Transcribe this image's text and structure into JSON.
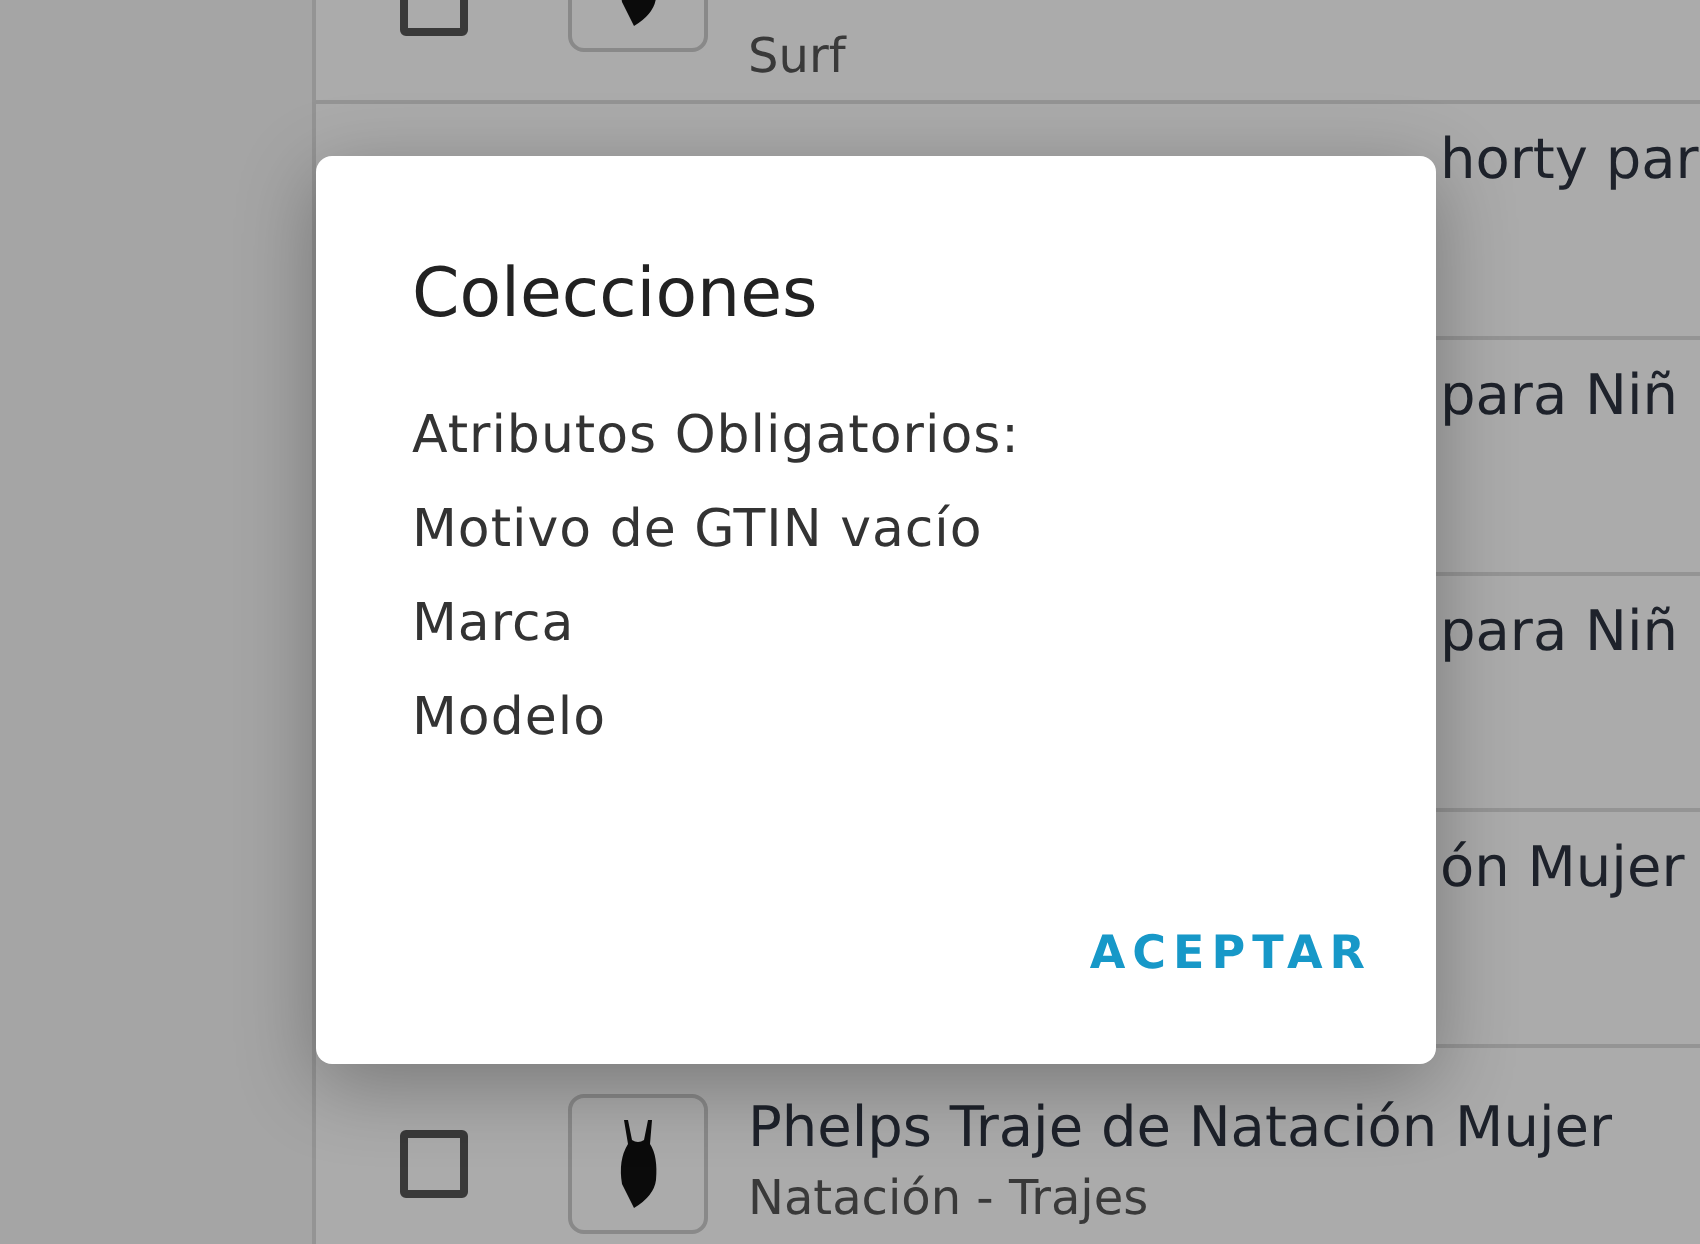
{
  "list": {
    "items": [
      {
        "kind": "visible",
        "checked": false,
        "subtitle": "Surf"
      },
      {
        "kind": "covered",
        "title": "horty par"
      },
      {
        "kind": "covered",
        "title": "para Niñ"
      },
      {
        "kind": "covered",
        "title": "para Niñ"
      },
      {
        "kind": "covered",
        "title": "ón Mujer"
      },
      {
        "kind": "visible",
        "checked": false,
        "title": "Phelps Traje de Natación Mujer",
        "subtitle": "Natación - Trajes"
      }
    ]
  },
  "dialog": {
    "title": "Colecciones",
    "lines": [
      "Atributos Obligatorios:",
      "Motivo de GTIN vacío",
      "Marca",
      "Modelo"
    ],
    "button": "ACEPTAR"
  }
}
